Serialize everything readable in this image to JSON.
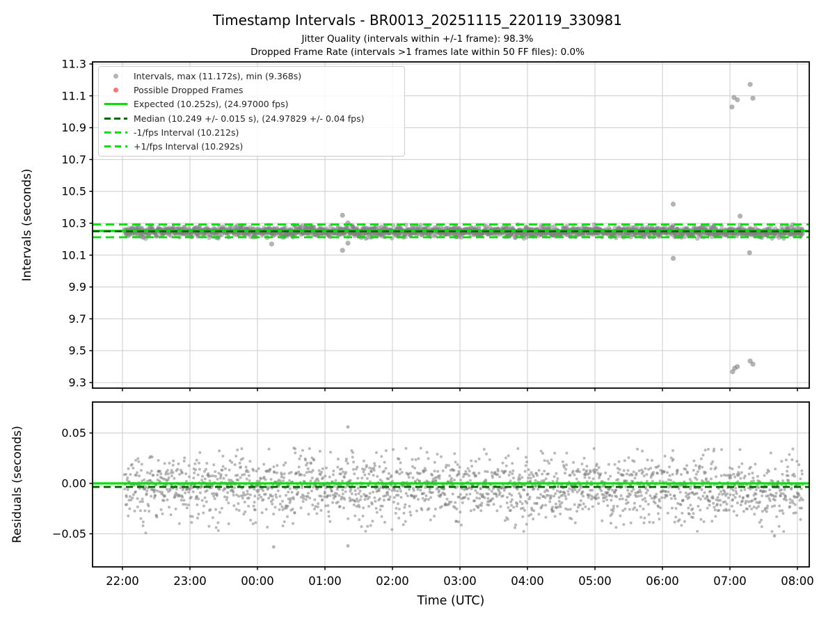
{
  "figure": {
    "title": "Timestamp Intervals - BR0013_20251115_220119_330981",
    "subtitle1": "Jitter Quality (intervals within +/-1 frame): 98.3%",
    "subtitle2": "Dropped Frame Rate (intervals >1 frames late within 50 FF files): 0.0%"
  },
  "colors": {
    "point": "#808080",
    "point_opacity_top": 0.5,
    "point_opacity_bottom": 0.55,
    "dropped": "rgba(255,0,0,0.55)",
    "expected": "#00e000",
    "median": "#006400",
    "fps_interval": "#00e000",
    "grid": "#cccccc",
    "spine": "#000000",
    "tick_text": "#000000"
  },
  "x_axis": {
    "label": "Time (UTC)",
    "tick_labels": [
      "22:00",
      "23:00",
      "00:00",
      "01:00",
      "02:00",
      "03:00",
      "04:00",
      "05:00",
      "06:00",
      "07:00",
      "08:00"
    ],
    "tick_hours": [
      0,
      1,
      2,
      3,
      4,
      5,
      6,
      7,
      8,
      9,
      10
    ],
    "lim_hours": [
      -0.443,
      10.175
    ]
  },
  "legend": {
    "items": [
      {
        "marker": "dot-gray",
        "label": "Intervals, max (11.172s), min (9.368s)"
      },
      {
        "marker": "dot-red",
        "label": "Possible Dropped Frames"
      },
      {
        "marker": "line-solid",
        "label": "Expected (10.252s), (24.97000 fps)"
      },
      {
        "marker": "line-dash-dark",
        "label": "Median (10.249 +/- 0.015 s), (24.97829 +/- 0.04 fps)"
      },
      {
        "marker": "line-dash-lime",
        "label": "-1/fps Interval (10.212s)"
      },
      {
        "marker": "line-dash-lime",
        "label": "+1/fps Interval (10.292s)"
      }
    ]
  },
  "chart_data": [
    {
      "id": "intervals",
      "type": "scatter",
      "ylabel": "Intervals (seconds)",
      "ytick_values": [
        11.3,
        11.1,
        10.9,
        10.7,
        10.5,
        10.3,
        10.1,
        9.9,
        9.7,
        9.5,
        9.3
      ],
      "ytick_labels": [
        "11.3",
        "11.1",
        "10.9",
        "10.7",
        "10.5",
        "10.3",
        "10.1",
        "9.9",
        "9.7",
        "9.5",
        "9.3"
      ],
      "ylim": [
        9.265,
        11.313
      ],
      "stats": {
        "max_s": 11.172,
        "min_s": 9.368,
        "expected_s": 10.252,
        "expected_fps": "24.97000",
        "median_s": 10.249,
        "median_err_s": 0.015,
        "measured_fps": 24.97829,
        "measured_fps_err": 0.04,
        "minus_1fps_s": 10.212,
        "plus_1fps_s": 10.292,
        "jitter_quality_pct": 98.3,
        "dropped_frame_rate_pct": 0.0,
        "ff_files": 50
      },
      "lines": [
        {
          "name": "expected-line",
          "value": 10.252,
          "dash": null,
          "color": "expected",
          "width": 3.2
        },
        {
          "name": "median-line",
          "value": 10.249,
          "dash": "10 6",
          "color": "median",
          "width": 2.8
        },
        {
          "name": "minus-1fps-line",
          "value": 10.212,
          "dash": "12 7",
          "color": "fps_interval",
          "width": 2.8
        },
        {
          "name": "plus-1fps-line",
          "value": 10.292,
          "dash": "12 7",
          "color": "fps_interval",
          "width": 2.8
        }
      ],
      "cloud": {
        "n": 2200,
        "h_start": 0.03,
        "h_end": 10.08,
        "base": 10.252,
        "rows": [
          0.032,
          0.021,
          0.01,
          -0.002,
          -0.013,
          -0.024,
          -0.035,
          -0.045
        ],
        "weights": [
          1.5,
          6,
          19,
          32,
          23,
          12,
          5,
          1.5
        ],
        "noise_sd": 0.0033,
        "radius": 3.2,
        "clamp": [
          10.19,
          10.297
        ]
      },
      "outliers": [
        [
          2.21,
          10.17
        ],
        [
          3.26,
          10.35
        ],
        [
          3.26,
          10.13
        ],
        [
          3.34,
          10.302
        ],
        [
          3.34,
          10.175
        ],
        [
          8.16,
          10.42
        ],
        [
          8.16,
          10.08
        ],
        [
          9.03,
          11.03
        ],
        [
          9.06,
          11.09
        ],
        [
          9.11,
          11.075
        ],
        [
          9.3,
          11.172
        ],
        [
          9.34,
          11.085
        ],
        [
          9.04,
          9.368
        ],
        [
          9.07,
          9.39
        ],
        [
          9.11,
          9.4
        ],
        [
          9.3,
          9.435
        ],
        [
          9.34,
          9.415
        ],
        [
          9.29,
          10.115
        ],
        [
          9.15,
          10.345
        ]
      ],
      "dropped_frames": []
    },
    {
      "id": "residuals",
      "type": "scatter",
      "ylabel": "Residuals (seconds)",
      "ytick_values": [
        0.05,
        0.0,
        -0.05
      ],
      "ytick_labels": [
        "0.05",
        "0.00",
        "−0.05"
      ],
      "ylim": [
        -0.0828,
        0.0807
      ],
      "lines": [
        {
          "name": "expected-line",
          "value": 0.0,
          "dash": null,
          "color": "expected",
          "width": 3.2
        },
        {
          "name": "median-line",
          "value": -0.0035,
          "dash": "10 6",
          "color": "median",
          "width": 2.8
        }
      ],
      "cloud": {
        "n": 2200,
        "h_start": 0.03,
        "h_end": 10.08,
        "base": 0,
        "rows": [
          0.032,
          0.021,
          0.01,
          -0.002,
          -0.013,
          -0.024,
          -0.035,
          -0.045
        ],
        "weights": [
          1.5,
          6,
          19,
          32,
          23,
          12,
          5,
          1.5
        ],
        "noise_sd": 0.0033,
        "radius": 2.0,
        "clamp": [
          -0.0495,
          0.0345
        ]
      },
      "outliers": [
        [
          3.34,
          0.056
        ],
        [
          2.24,
          -0.063
        ],
        [
          3.34,
          -0.062
        ],
        [
          9.66,
          -0.052
        ]
      ],
      "dropped_frames": []
    }
  ]
}
